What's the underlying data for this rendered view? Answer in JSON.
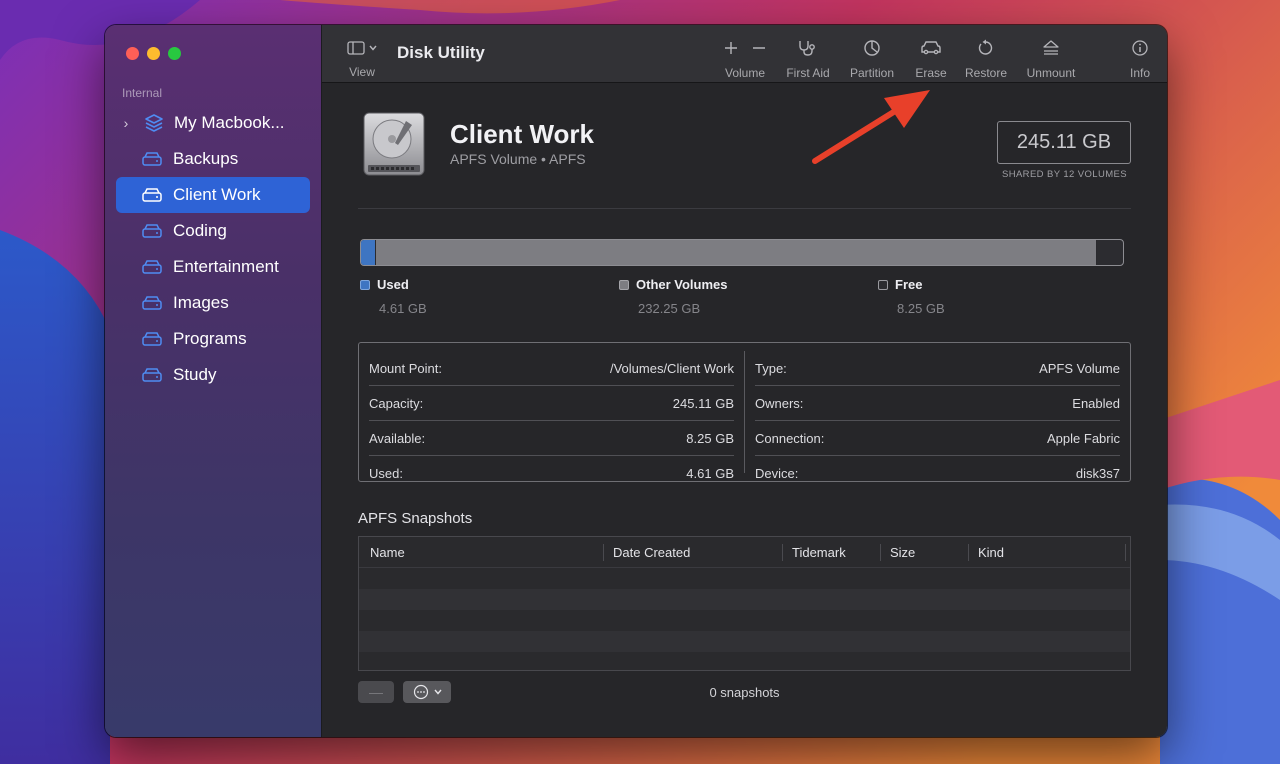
{
  "app": {
    "title": "Disk Utility"
  },
  "sidebar": {
    "section": "Internal",
    "root": {
      "label": "My Macbook..."
    },
    "items": [
      {
        "label": "Backups",
        "selected": false
      },
      {
        "label": "Client Work",
        "selected": true
      },
      {
        "label": "Coding",
        "selected": false
      },
      {
        "label": "Entertainment",
        "selected": false
      },
      {
        "label": "Images",
        "selected": false
      },
      {
        "label": "Programs",
        "selected": false
      },
      {
        "label": "Study",
        "selected": false
      }
    ]
  },
  "toolbar": {
    "view": "View",
    "volume": "Volume",
    "first_aid": "First Aid",
    "partition": "Partition",
    "erase": "Erase",
    "restore": "Restore",
    "unmount": "Unmount",
    "info": "Info"
  },
  "volume": {
    "name": "Client Work",
    "subtitle": "APFS Volume • APFS",
    "capacity": "245.11 GB",
    "shared": "SHARED BY 12 VOLUMES"
  },
  "usage": {
    "used": {
      "label": "Used",
      "value": "4.61 GB",
      "fraction": 0.0188,
      "color": "#3e75c2"
    },
    "other": {
      "label": "Other Volumes",
      "value": "232.25 GB",
      "fraction": 0.9475,
      "color": "#7d7d82"
    },
    "free": {
      "label": "Free",
      "value": "8.25 GB",
      "fraction": 0.0337,
      "color": "#2c2c30"
    }
  },
  "info": {
    "left": [
      {
        "key": "Mount Point:",
        "value": "/Volumes/Client Work"
      },
      {
        "key": "Capacity:",
        "value": "245.11 GB"
      },
      {
        "key": "Available:",
        "value": "8.25 GB"
      },
      {
        "key": "Used:",
        "value": "4.61 GB"
      }
    ],
    "right": [
      {
        "key": "Type:",
        "value": "APFS Volume"
      },
      {
        "key": "Owners:",
        "value": "Enabled"
      },
      {
        "key": "Connection:",
        "value": "Apple Fabric"
      },
      {
        "key": "Device:",
        "value": "disk3s7"
      }
    ]
  },
  "snapshots": {
    "title": "APFS Snapshots",
    "columns": [
      "Name",
      "Date Created",
      "Tidemark",
      "Size",
      "Kind"
    ],
    "count": "0 snapshots",
    "minus": "—"
  },
  "colors": {
    "accent": "#2e63d6",
    "annotation_arrow": "#e8402a"
  }
}
